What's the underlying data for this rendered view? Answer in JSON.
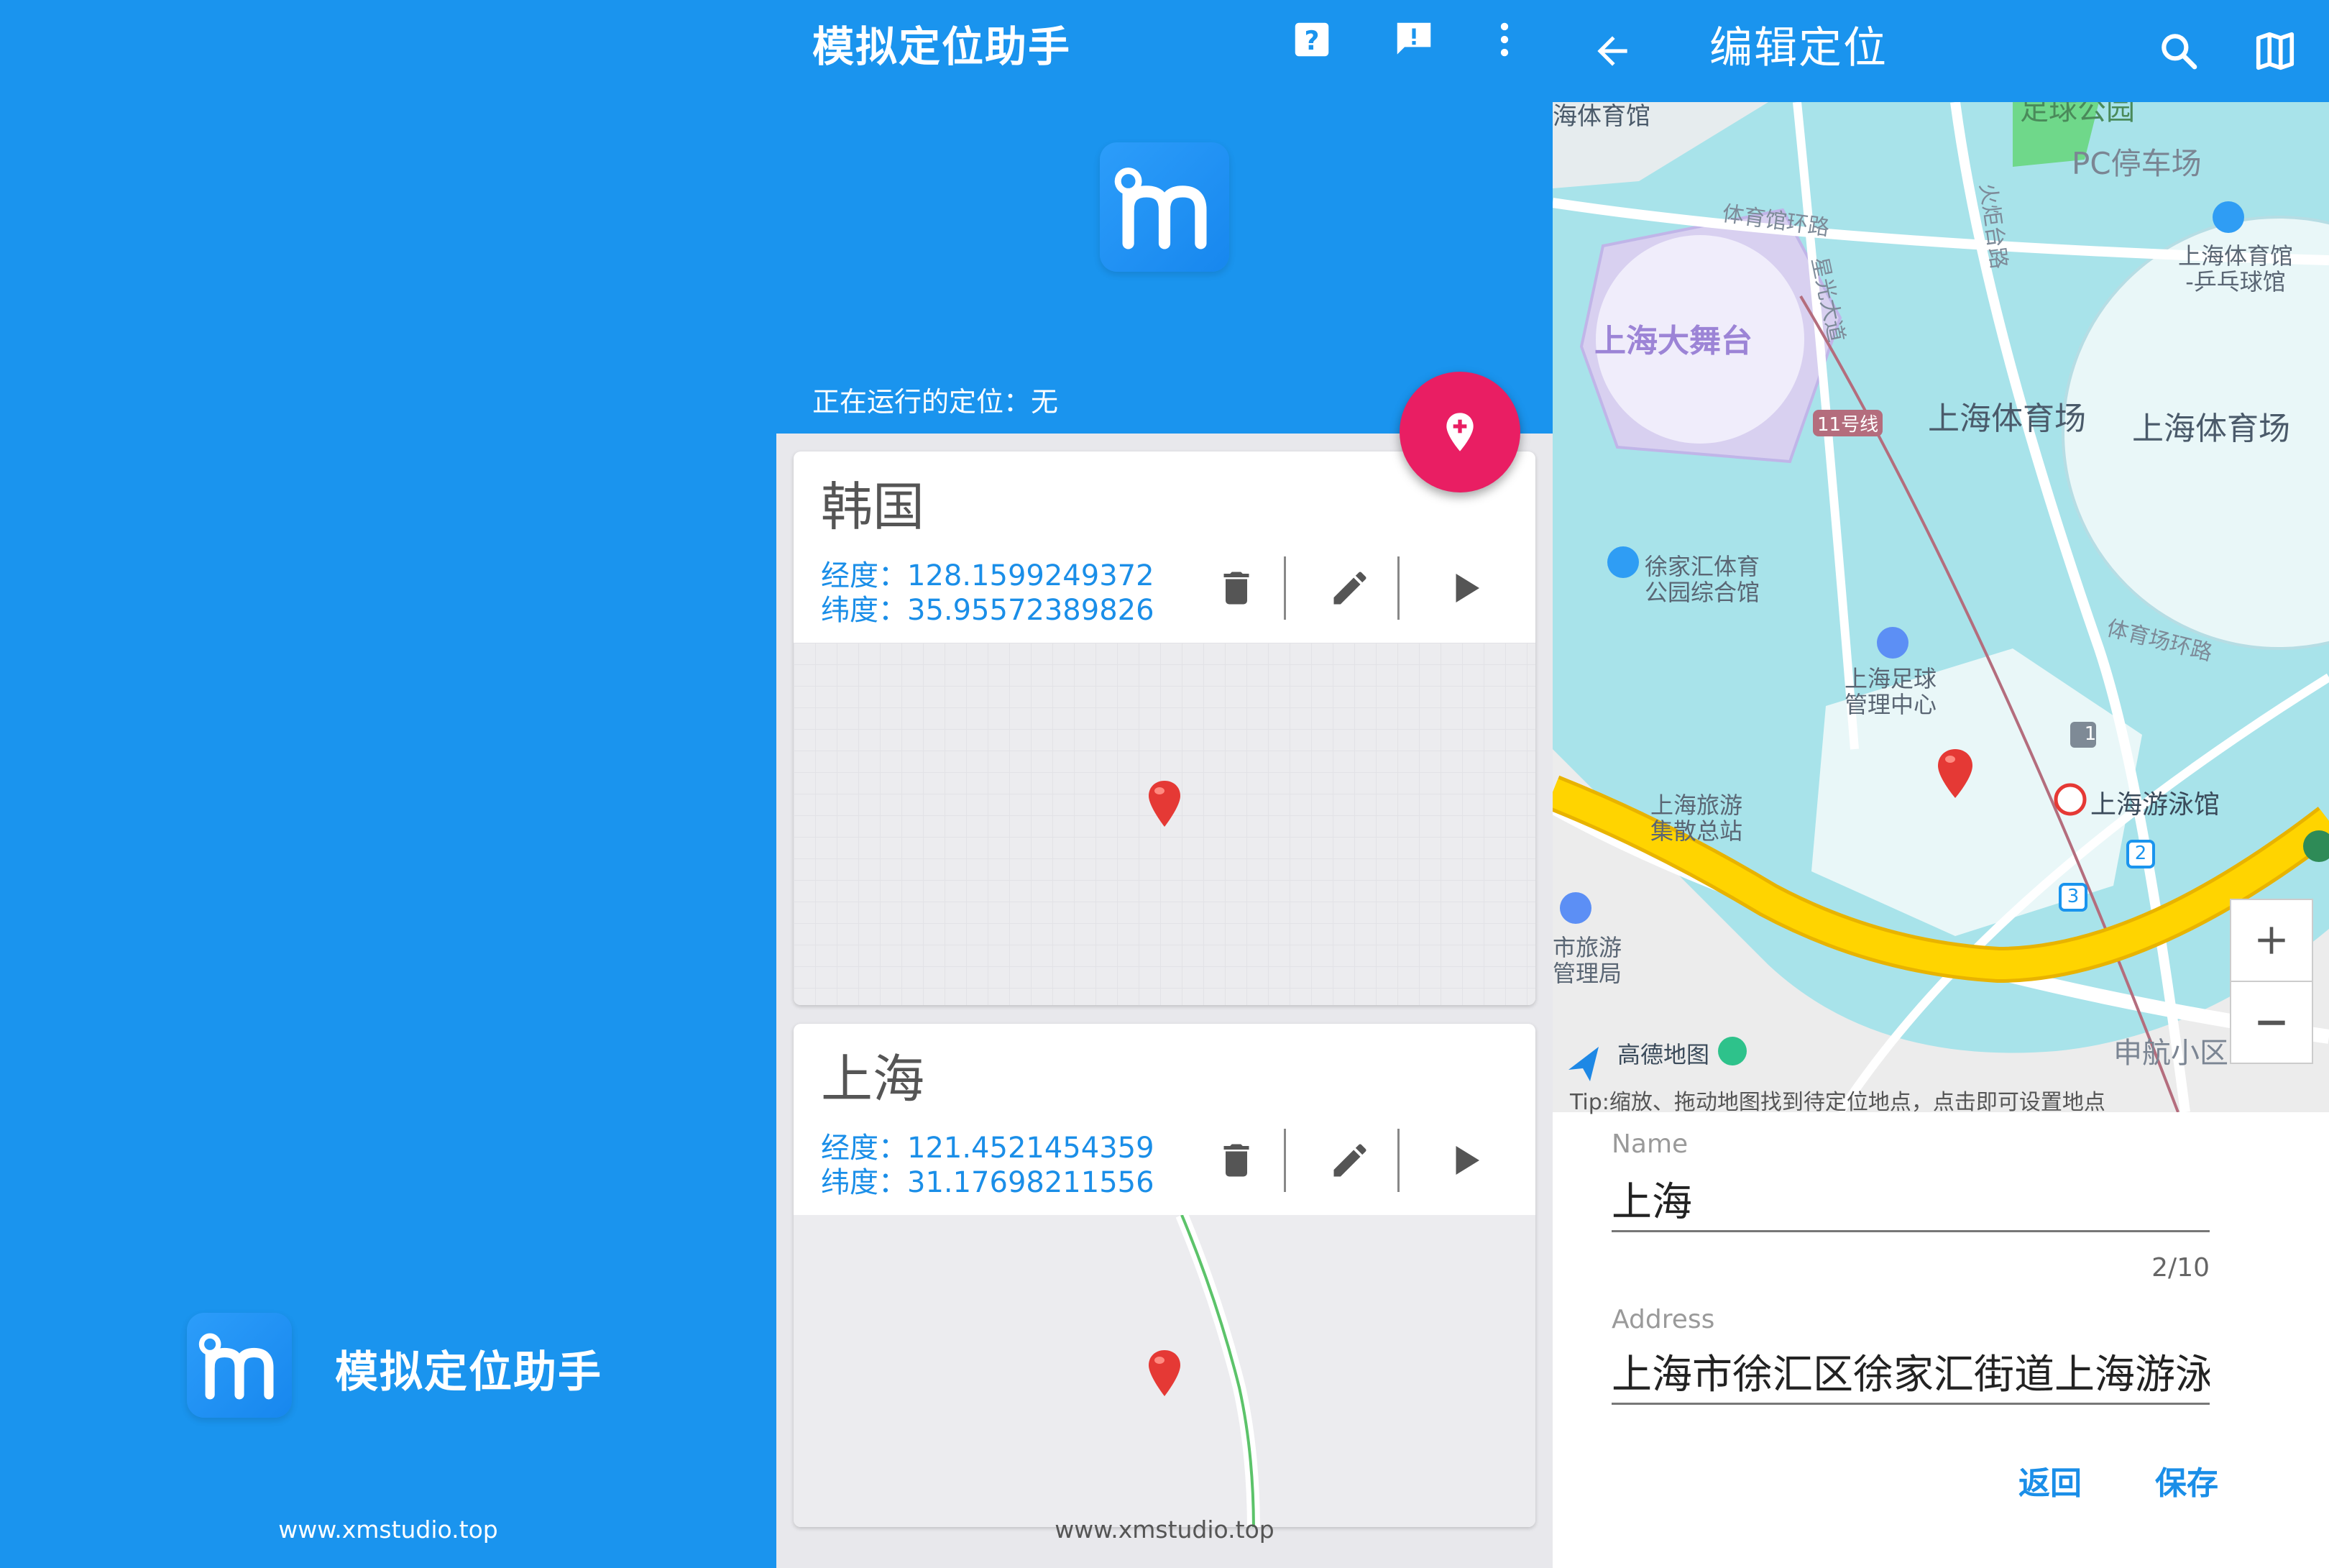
{
  "splash": {
    "app_title": "模拟定位助手",
    "website": "www.xmstudio.top"
  },
  "main": {
    "app_title": "模拟定位助手",
    "toolbar_icons": [
      "help-icon",
      "feedback-icon",
      "more-vert-icon"
    ],
    "running_label": "正在运行的定位：无",
    "fab_icon": "add-location-icon",
    "locations": [
      {
        "name": "韩国",
        "longitude": "经度：128.1599249372",
        "latitude": "纬度：35.95572389826"
      },
      {
        "name": "上海",
        "longitude": "经度：121.4521454359",
        "latitude": "纬度：31.17698211556"
      }
    ],
    "website": "www.xmstudio.top"
  },
  "edit": {
    "title": "编辑定位",
    "toolbar_icons": [
      "back-arrow-icon",
      "search-icon",
      "map-icon"
    ],
    "map": {
      "labels": {
        "stage": "上海大舞台",
        "parking": "PC停车场",
        "stadium1": "上海体育场",
        "stadium2": "上海体育场",
        "pingpong": "上海体育馆\n-乒乓球馆",
        "xujiahui": "徐家汇体育\n公园综合馆",
        "football": "上海足球\n管理中心",
        "swim": "上海游泳馆",
        "tourism": "上海旅游\n集散总站",
        "bureau": "市旅游\n管理局",
        "shenhang": "申航小区",
        "ring1": "体育馆环路",
        "ring2": "体育场环路",
        "road1": "火炬台路",
        "road2": "星光大道",
        "line11": "11号线",
        "park": "足球公园",
        "gym": "海体育馆",
        "brand": "高德地图",
        "station_exits": [
          "1",
          "2",
          "3"
        ]
      },
      "tip": "Tip:缩放、拖动地图找到待定位地点，点击即可设置地点"
    },
    "name_label": "Name",
    "name_value": "上海",
    "name_counter": "2/10",
    "address_label": "Address",
    "address_value": "上海市徐汇区徐家汇街道上海游泳馆",
    "cancel_button": "返回",
    "save_button": "保存"
  },
  "colors": {
    "primary": "#1a94ee",
    "fab": "#e91e63",
    "link": "#1a8ee8",
    "road_yellow": "#ffd400",
    "water": "#a8e3ea"
  }
}
